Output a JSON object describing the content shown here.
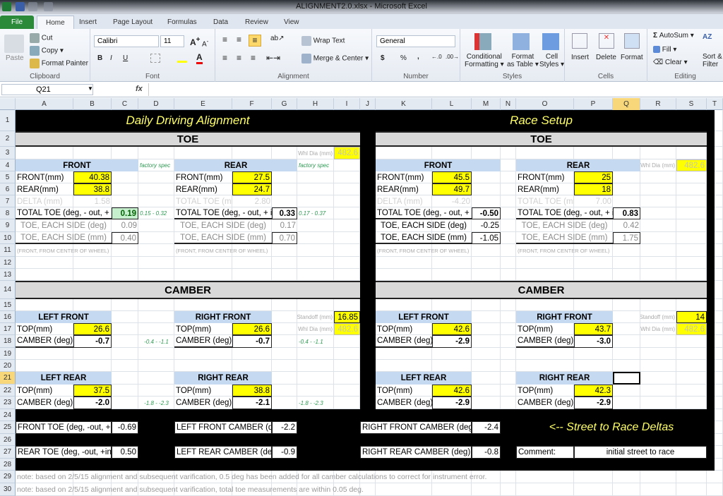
{
  "window": {
    "title": "ALIGNMENT2.0.xlsx  -  Microsoft Excel"
  },
  "tabs": [
    "File",
    "Home",
    "Insert",
    "Page Layout",
    "Formulas",
    "Data",
    "Review",
    "View"
  ],
  "active_tab": "Home",
  "ribbon": {
    "clipboard": {
      "label": "Clipboard",
      "paste": "Paste",
      "cut": "Cut",
      "copy": "Copy",
      "format_painter": "Format Painter"
    },
    "font": {
      "label": "Font",
      "name": "Calibri",
      "size": "11",
      "bold": "B",
      "italic": "I",
      "underline": "U"
    },
    "alignment": {
      "label": "Alignment",
      "wrap": "Wrap Text",
      "merge": "Merge & Center"
    },
    "number": {
      "label": "Number",
      "format": "General",
      "currency": "$",
      "percent": "%",
      "comma": ","
    },
    "styles": {
      "label": "Styles",
      "conditional": "Conditional",
      "conditional2": "Formatting",
      "format_table": "Format",
      "format_table2": "as Table",
      "cell_styles": "Cell",
      "cell_styles2": "Styles"
    },
    "cells": {
      "label": "Cells",
      "insert": "Insert",
      "delete": "Delete",
      "format": "Format"
    },
    "editing": {
      "label": "Editing",
      "autosum": "AutoSum",
      "fill": "Fill",
      "clear": "Clear",
      "sort": "Sort &",
      "sort2": "Filter"
    }
  },
  "formula_bar": {
    "name_box": "Q21",
    "fx": "fx",
    "value": ""
  },
  "columns": [
    "A",
    "B",
    "C",
    "D",
    "E",
    "F",
    "G",
    "H",
    "I",
    "J",
    "K",
    "L",
    "M",
    "N",
    "O",
    "P",
    "Q",
    "R",
    "S",
    "T"
  ],
  "selected_column": "Q",
  "selected_row": 21,
  "rows": [
    1,
    2,
    3,
    4,
    5,
    6,
    7,
    8,
    9,
    10,
    11,
    12,
    13,
    14,
    15,
    16,
    17,
    18,
    19,
    20,
    21,
    22,
    23,
    24,
    25,
    26,
    27,
    28,
    29,
    30
  ],
  "colors": {
    "input": "#ffff00",
    "header": "#c5d9f1",
    "band": "#d9d9d9",
    "title": "#ffff66",
    "spec": "#2e9a52",
    "good": "#c6efce"
  },
  "cells": [
    {
      "ref": "A1:I1",
      "text": "Daily Driving Alignment",
      "style": "title"
    },
    {
      "ref": "K1:S1",
      "text": "Race Setup",
      "style": "title"
    },
    {
      "ref": "A2:I2",
      "text": "TOE",
      "style": "band"
    },
    {
      "ref": "K2:S2",
      "text": "TOE",
      "style": "band"
    },
    {
      "ref": "H3",
      "text": "Whl Dia (mm)",
      "style": "tinyr"
    },
    {
      "ref": "I3",
      "text": "482.6",
      "style": "inpf"
    },
    {
      "ref": "A4:C4",
      "text": "FRONT",
      "style": "hdr"
    },
    {
      "ref": "D4",
      "text": "factory spec",
      "style": "spec"
    },
    {
      "ref": "E4:G4",
      "text": "REAR",
      "style": "hdr"
    },
    {
      "ref": "H4",
      "text": "factory spec",
      "style": "spec"
    },
    {
      "ref": "A5",
      "text": "FRONT(mm)",
      "style": ""
    },
    {
      "ref": "B5",
      "text": "40.38",
      "style": "inp"
    },
    {
      "ref": "E5",
      "text": "FRONT(mm)",
      "style": ""
    },
    {
      "ref": "F5",
      "text": "27.5",
      "style": "inp"
    },
    {
      "ref": "A6",
      "text": "REAR(mm)",
      "style": ""
    },
    {
      "ref": "B6",
      "text": "38.8",
      "style": "inp"
    },
    {
      "ref": "E6",
      "text": "REAR(mm)",
      "style": ""
    },
    {
      "ref": "F6",
      "text": "24.7",
      "style": "inp"
    },
    {
      "ref": "A7",
      "text": "DELTA (mm)",
      "style": "faint"
    },
    {
      "ref": "B7",
      "text": "1.58",
      "style": "faint r"
    },
    {
      "ref": "E7",
      "text": "TOTAL TOE (mm",
      "style": "faint"
    },
    {
      "ref": "F7",
      "text": "2.80",
      "style": "faint r"
    },
    {
      "ref": "A8:B8",
      "text": "TOTAL TOE (deg, - out, + in",
      "style": "bb"
    },
    {
      "ref": "C8",
      "text": "0.19",
      "style": "grn"
    },
    {
      "ref": "D8",
      "text": "0.15 - 0.32",
      "style": "spec"
    },
    {
      "ref": "E8:F8",
      "text": "TOTAL TOE (deg, - out, + in",
      "style": "bb"
    },
    {
      "ref": "G8",
      "text": "0.33",
      "style": "out"
    },
    {
      "ref": "H8",
      "text": "0.17 - 0.37",
      "style": "spec"
    },
    {
      "ref": "A9:B9",
      "text": "TOE, EACH SIDE (deg)",
      "style": "gray ce"
    },
    {
      "ref": "C9",
      "text": "0.09",
      "style": "gray r"
    },
    {
      "ref": "E9:F9",
      "text": "TOE, EACH SIDE (deg)",
      "style": "gray ce"
    },
    {
      "ref": "G9",
      "text": "0.17",
      "style": "gray r"
    },
    {
      "ref": "A10:B10",
      "text": "TOE,  EACH SIDE (mm)",
      "style": "gray ce bb"
    },
    {
      "ref": "C10",
      "text": "0.40",
      "style": "outn gray"
    },
    {
      "ref": "E10:F10",
      "text": "TOE,  EACH SIDE (mm)",
      "style": "gray ce bb"
    },
    {
      "ref": "G10",
      "text": "0.70",
      "style": "outn gray"
    },
    {
      "ref": "A11:C11",
      "text": "(FRONT, FROM CENTER OF WHEEL)",
      "style": "tiny"
    },
    {
      "ref": "E11:G11",
      "text": "(FRONT, FROM CENTER OF WHEEL)",
      "style": "tiny"
    },
    {
      "ref": "K4:M4",
      "text": "FRONT",
      "style": "hdr"
    },
    {
      "ref": "O4:Q4",
      "text": "REAR",
      "style": "hdr"
    },
    {
      "ref": "R4",
      "text": "Whl Dia (mm)",
      "style": "tinyr"
    },
    {
      "ref": "S4",
      "text": "482.6",
      "style": "inpf"
    },
    {
      "ref": "K5",
      "text": "FRONT(mm)",
      "style": ""
    },
    {
      "ref": "L5",
      "text": "45.5",
      "style": "inp"
    },
    {
      "ref": "O5",
      "text": "FRONT(mm)",
      "style": ""
    },
    {
      "ref": "P5",
      "text": "25",
      "style": "inp"
    },
    {
      "ref": "K6",
      "text": "REAR(mm)",
      "style": ""
    },
    {
      "ref": "L6",
      "text": "49.7",
      "style": "inp"
    },
    {
      "ref": "O6",
      "text": "REAR(mm)",
      "style": ""
    },
    {
      "ref": "P6",
      "text": "18",
      "style": "inp"
    },
    {
      "ref": "K7",
      "text": "DELTA (mm)",
      "style": "faint"
    },
    {
      "ref": "L7",
      "text": "-4.20",
      "style": "faint r"
    },
    {
      "ref": "O7",
      "text": "TOTAL TOE (mm",
      "style": "faint"
    },
    {
      "ref": "P7",
      "text": "7.00",
      "style": "faint r"
    },
    {
      "ref": "K8:L8",
      "text": "TOTAL TOE (deg, - out, + in",
      "style": "bb"
    },
    {
      "ref": "M8",
      "text": "-0.50",
      "style": "out"
    },
    {
      "ref": "O8:P8",
      "text": "TOTAL TOE (deg, - out, + in",
      "style": "bb"
    },
    {
      "ref": "Q8",
      "text": "0.83",
      "style": "out"
    },
    {
      "ref": "K9:L9",
      "text": "TOE, EACH SIDE (deg)",
      "style": "ce"
    },
    {
      "ref": "M9",
      "text": "-0.25",
      "style": "r"
    },
    {
      "ref": "O9:P9",
      "text": "TOE, EACH SIDE (deg)",
      "style": "gray ce"
    },
    {
      "ref": "Q9",
      "text": "0.42",
      "style": "gray r"
    },
    {
      "ref": "K10:L10",
      "text": "TOE,  EACH SIDE (mm)",
      "style": "ce bb"
    },
    {
      "ref": "M10",
      "text": "-1.05",
      "style": "outn"
    },
    {
      "ref": "O10:P10",
      "text": "TOE,  EACH SIDE (mm)",
      "style": "gray ce bb"
    },
    {
      "ref": "Q10",
      "text": "1.75",
      "style": "outn gray"
    },
    {
      "ref": "K11:M11",
      "text": "(FRONT, FROM CENTER OF WHEEL)",
      "style": "tiny"
    },
    {
      "ref": "O11:Q11",
      "text": "(FRONT, FROM CENTER OF WHEEL)",
      "style": "tiny"
    },
    {
      "ref": "A14:I14",
      "text": "CAMBER",
      "style": "band"
    },
    {
      "ref": "K14:S14",
      "text": "CAMBER",
      "style": "band"
    },
    {
      "ref": "A16:B16",
      "text": "LEFT FRONT",
      "style": "hdr"
    },
    {
      "ref": "E16:F16",
      "text": "RIGHT FRONT",
      "style": "hdr"
    },
    {
      "ref": "H16",
      "text": "Standoff (mm)",
      "style": "tinyr"
    },
    {
      "ref": "I16",
      "text": "16.85",
      "style": "inp"
    },
    {
      "ref": "A17",
      "text": "TOP(mm)",
      "style": ""
    },
    {
      "ref": "B17",
      "text": "26.6",
      "style": "inp"
    },
    {
      "ref": "E17",
      "text": "TOP(mm)",
      "style": ""
    },
    {
      "ref": "F17",
      "text": "26.6",
      "style": "inp"
    },
    {
      "ref": "H17",
      "text": "Whl Dia (mm)",
      "style": "tinyr"
    },
    {
      "ref": "I17",
      "text": "482.6",
      "style": "inpf"
    },
    {
      "ref": "A18",
      "text": "CAMBER (deg)",
      "style": "bb"
    },
    {
      "ref": "B18",
      "text": "-0.7",
      "style": "out"
    },
    {
      "ref": "D18",
      "text": "-0.4 - -1.1",
      "style": "spec ce"
    },
    {
      "ref": "E18",
      "text": "CAMBER (deg)",
      "style": "bb"
    },
    {
      "ref": "F18",
      "text": "-0.7",
      "style": "out"
    },
    {
      "ref": "H18",
      "text": "-0.4 - -1.1",
      "style": "spec"
    },
    {
      "ref": "A21:B21",
      "text": "LEFT REAR",
      "style": "hdr"
    },
    {
      "ref": "E21:F21",
      "text": "RIGHT REAR",
      "style": "hdr"
    },
    {
      "ref": "A22",
      "text": "TOP(mm)",
      "style": ""
    },
    {
      "ref": "B22",
      "text": "37.5",
      "style": "inp"
    },
    {
      "ref": "E22",
      "text": "TOP(mm)",
      "style": ""
    },
    {
      "ref": "F22",
      "text": "38.8",
      "style": "inp"
    },
    {
      "ref": "A23",
      "text": "CAMBER (deg)",
      "style": ""
    },
    {
      "ref": "B23",
      "text": "-2.0",
      "style": "out"
    },
    {
      "ref": "D23",
      "text": "-1.8 - -2.3",
      "style": "spec ce"
    },
    {
      "ref": "E23",
      "text": "CAMBER (deg)",
      "style": ""
    },
    {
      "ref": "F23",
      "text": "-2.1",
      "style": "out"
    },
    {
      "ref": "H23",
      "text": "-1.8 - -2.3",
      "style": "spec"
    },
    {
      "ref": "K16:L16",
      "text": "LEFT FRONT",
      "style": "hdr"
    },
    {
      "ref": "O16:P16",
      "text": "RIGHT FRONT",
      "style": "hdr"
    },
    {
      "ref": "R16",
      "text": "Standoff (mm)",
      "style": "tinyr"
    },
    {
      "ref": "S16",
      "text": "14",
      "style": "inp"
    },
    {
      "ref": "K17",
      "text": "TOP(mm)",
      "style": ""
    },
    {
      "ref": "L17",
      "text": "42.6",
      "style": "inp"
    },
    {
      "ref": "O17",
      "text": "TOP(mm)",
      "style": ""
    },
    {
      "ref": "P17",
      "text": "43.7",
      "style": "inp"
    },
    {
      "ref": "R17",
      "text": "Whl Dia (mm)",
      "style": "tinyr"
    },
    {
      "ref": "S17",
      "text": "482.6",
      "style": "inpf"
    },
    {
      "ref": "K18",
      "text": "CAMBER (deg)",
      "style": "bb"
    },
    {
      "ref": "L18",
      "text": "-2.9",
      "style": "out"
    },
    {
      "ref": "O18",
      "text": "CAMBER (deg)",
      "style": "bb"
    },
    {
      "ref": "P18",
      "text": "-3.0",
      "style": "out"
    },
    {
      "ref": "K21:L21",
      "text": "LEFT REAR",
      "style": "hdr"
    },
    {
      "ref": "O21:P21",
      "text": "RIGHT REAR",
      "style": "hdr"
    },
    {
      "ref": "K22",
      "text": "TOP(mm)",
      "style": ""
    },
    {
      "ref": "L22",
      "text": "42.6",
      "style": "inp"
    },
    {
      "ref": "O22",
      "text": "TOP(mm)",
      "style": ""
    },
    {
      "ref": "P22",
      "text": "42.3",
      "style": "inp"
    },
    {
      "ref": "K23",
      "text": "CAMBER (deg)",
      "style": ""
    },
    {
      "ref": "L23",
      "text": "-2.9",
      "style": "out"
    },
    {
      "ref": "O23",
      "text": "CAMBER (deg)",
      "style": ""
    },
    {
      "ref": "P23",
      "text": "-2.9",
      "style": "out"
    },
    {
      "ref": "A25:B25",
      "text": "FRONT TOE (deg, -out, +in",
      "style": "wb"
    },
    {
      "ref": "C25",
      "text": "-0.69",
      "style": "wbr"
    },
    {
      "ref": "E25:F25",
      "text": "LEFT FRONT CAMBER (deg",
      "style": "wb"
    },
    {
      "ref": "G25",
      "text": "-2.2",
      "style": "wbr"
    },
    {
      "ref": "J25:L25",
      "text": "RIGHT FRONT CAMBER (deg)",
      "style": "wb"
    },
    {
      "ref": "M25",
      "text": "-2.4",
      "style": "wbr"
    },
    {
      "ref": "O25:S25",
      "text": "<--  Street to Race Deltas",
      "style": "delta"
    },
    {
      "ref": "A27:B27",
      "text": "REAR TOE (deg, -out, +in)",
      "style": "wb"
    },
    {
      "ref": "C27",
      "text": "0.50",
      "style": "wbr"
    },
    {
      "ref": "E27:F27",
      "text": "LEFT REAR CAMBER (deg)",
      "style": "wb"
    },
    {
      "ref": "G27",
      "text": "-0.9",
      "style": "wbr"
    },
    {
      "ref": "J27:L27",
      "text": "RIGHT REAR CAMBER (deg)",
      "style": "wb"
    },
    {
      "ref": "M27",
      "text": "-0.8",
      "style": "wbr"
    },
    {
      "ref": "O27",
      "text": "Comment:",
      "style": "wb"
    },
    {
      "ref": "P27:S27",
      "text": "initial street to race",
      "style": "wb ce"
    },
    {
      "ref": "A29",
      "text": "note: based on 2/5/15 alignment and subsequent varification, 0.5 deg has been added for all camber calculations to correct for instrument error.",
      "style": "note"
    },
    {
      "ref": "A30",
      "text": "note: based on 2/5/15 alignment and subsequent varification, total toe measurements are within 0.05 deg.",
      "style": "note"
    }
  ]
}
